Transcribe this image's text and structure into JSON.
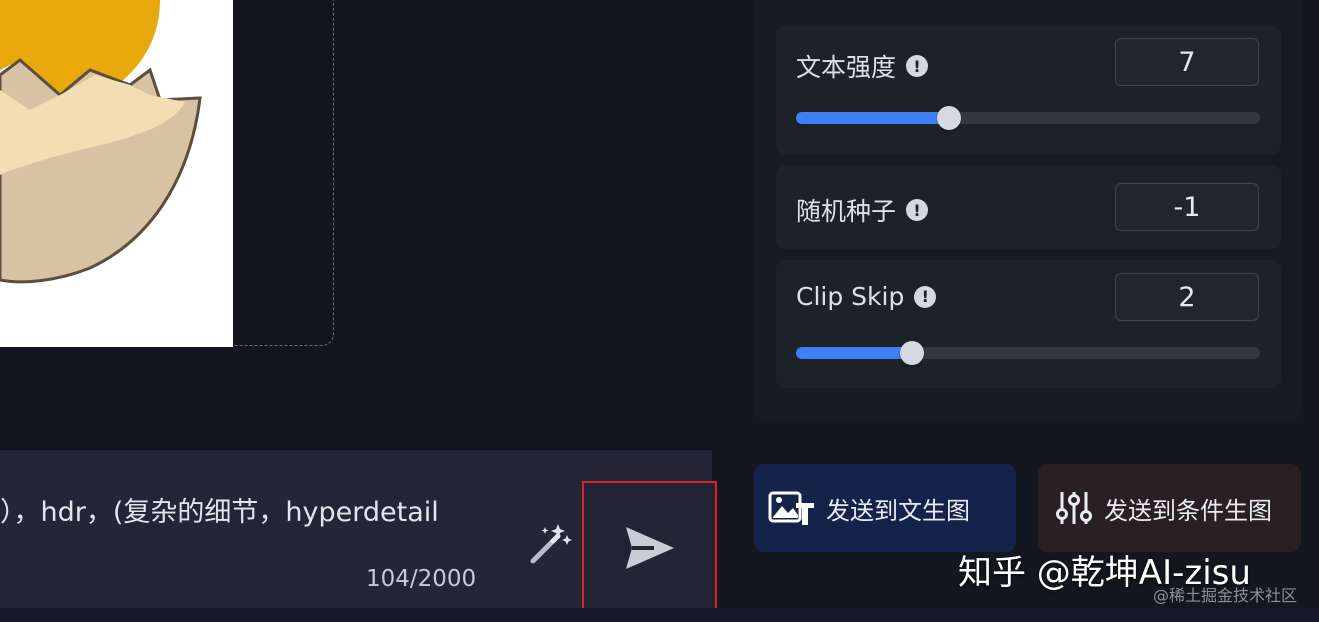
{
  "params": [
    {
      "label": "文本强度",
      "value": "7",
      "has_slider": true,
      "slider_fraction": 0.33
    },
    {
      "label": "随机种子",
      "value": "-1",
      "has_slider": false
    },
    {
      "label": "Clip Skip",
      "value": "2",
      "has_slider": true,
      "slider_fraction": 0.25
    }
  ],
  "info_icon_glyph": "!",
  "prompt": {
    "text": "），hdr，(复杂的细节，hyperdetail",
    "count": "104/2000"
  },
  "actions": {
    "send_to_txt2img": "发送到文生图",
    "send_to_cond": "发送到条件生图"
  },
  "watermark": {
    "main": "知乎 @乾坤AI-zisu",
    "small": "@稀土掘金技术社区"
  },
  "colors": {
    "accent": "#3d7ff5",
    "highlight": "#e0202a"
  },
  "icons": [
    "info-icon",
    "magic-wand-icon",
    "send-icon",
    "image-text-icon",
    "sliders-icon"
  ]
}
